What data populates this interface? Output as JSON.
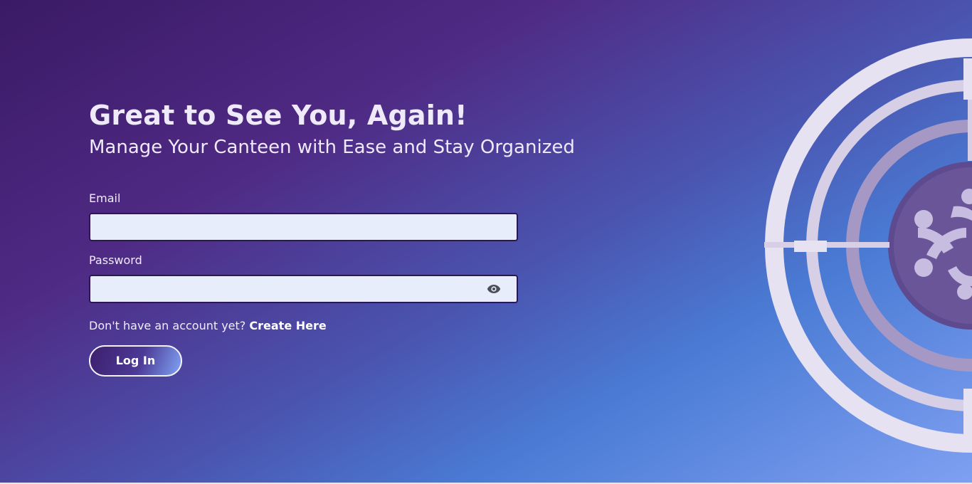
{
  "hero": {
    "title": "Great to See You, Again!",
    "subtitle": "Manage Your Canteen with Ease and Stay Organized"
  },
  "form": {
    "email_label": "Email",
    "email_value": "",
    "email_placeholder": "",
    "password_label": "Password",
    "password_value": "",
    "password_placeholder": "",
    "signup_prompt": "Don't have an account yet?",
    "signup_link": "Create Here",
    "login_label": "Log In"
  },
  "icons": {
    "password_toggle": "eye-icon",
    "decoration": "canteen-community-logo"
  },
  "colors": {
    "input_bg": "#e8edfc",
    "input_border": "#2c1850",
    "gradient_start": "#3a1a66",
    "gradient_end": "#7fa0f2"
  }
}
